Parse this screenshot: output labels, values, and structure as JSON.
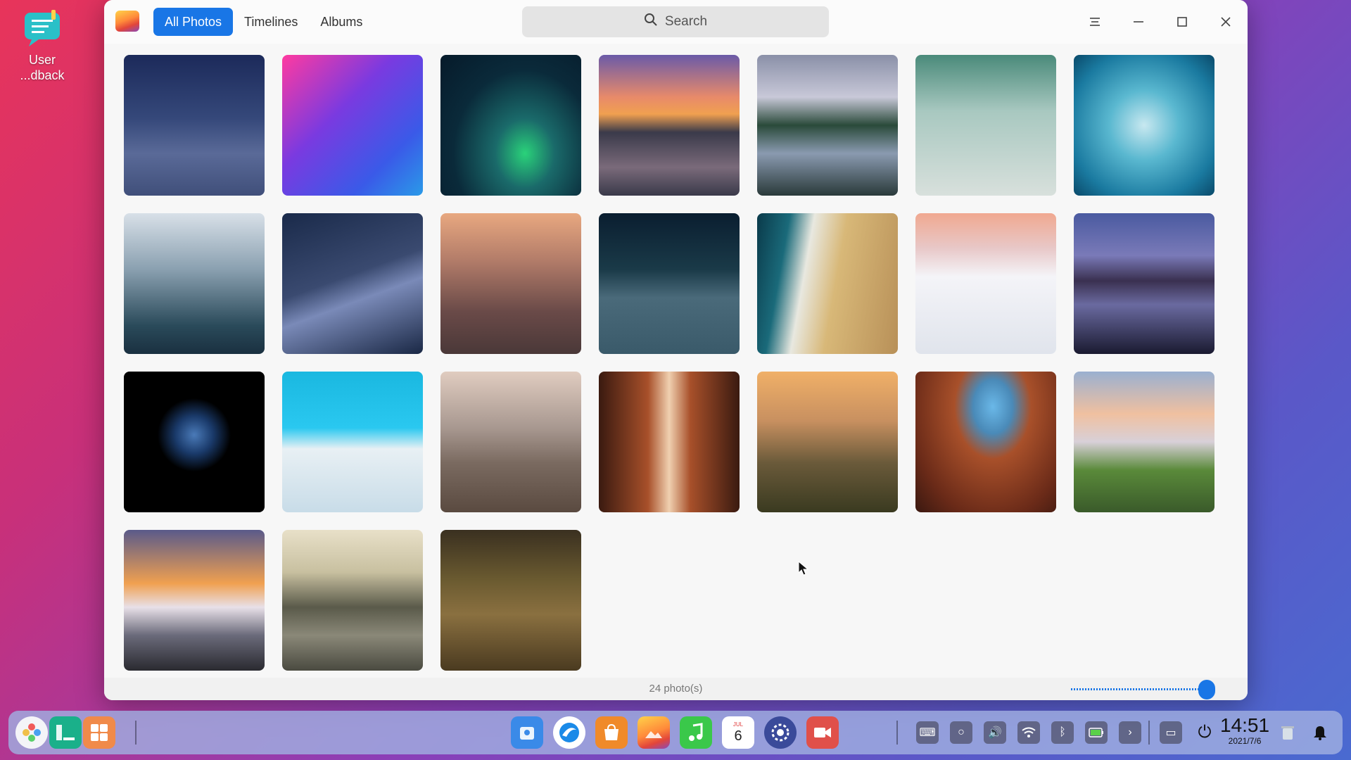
{
  "desktop": {
    "icon_label_line1": "User",
    "icon_label_line2": "...dback"
  },
  "window": {
    "tabs": [
      {
        "label": "All Photos",
        "active": true
      },
      {
        "label": "Timelines",
        "active": false
      },
      {
        "label": "Albums",
        "active": false
      }
    ],
    "search": {
      "placeholder": "Search"
    },
    "status": {
      "count_text": "24 photo(s)",
      "zoom_fraction": 1.0
    }
  },
  "photos": [
    {
      "name": "sand-ripples-night",
      "bg": "linear-gradient(180deg,#1c2a5a 0%,#35487a 45%,#5a6a98 70%,#404f7a 100%)"
    },
    {
      "name": "deepin-logo",
      "bg": "linear-gradient(135deg,#ff3aa0 0%,#7a3ae0 40%,#3a5ae8 75%,#2a9ae8 100%)"
    },
    {
      "name": "aurora",
      "bg": "radial-gradient(ellipse at 60% 70%,#2ad27a 0%,#1a6a6a 25%,#0a2a3a 60%,#061a2a 100%)"
    },
    {
      "name": "sunset-coast",
      "bg": "linear-gradient(180deg,#6a5aa8 0%,#e88a6a 30%,#f0a050 42%,#3a3a4a 55%,#7a6a7a 80%,#3a3a4a 100%)"
    },
    {
      "name": "mountain-lake",
      "bg": "linear-gradient(180deg,#8a90a8 0%,#c8c8d8 30%,#2a4a3a 50%,#8a9ab0 70%,#2a3a3a 100%)"
    },
    {
      "name": "waterfall-bird",
      "bg": "linear-gradient(180deg,#4a8a7a 0%,#a8c8c0 40%,#d8e0dc 100%)"
    },
    {
      "name": "jellyfish",
      "bg": "radial-gradient(circle at 50% 50%,#c8e8f0 0%,#5ab8d0 35%,#1a7aa0 75%,#0a4a6a 100%)"
    },
    {
      "name": "misty-forest",
      "bg": "linear-gradient(180deg,#d8e0e8 0%,#8aa0b0 40%,#2a4a5a 80%,#1a3040 100%)"
    },
    {
      "name": "blue-dune",
      "bg": "linear-gradient(160deg,#1a2a4a 0%,#3a4a70 45%,#7a8ab8 60%,#1a2845 100%)"
    },
    {
      "name": "desert-dusk",
      "bg": "linear-gradient(180deg,#e8a880 0%,#b07a68 35%,#6a4a48 70%,#4a3838 100%)"
    },
    {
      "name": "dark-clouds",
      "bg": "linear-gradient(180deg,#0a1e30 0%,#1a3a48 40%,#4a6a7a 60%,#3a5a6a 100%)"
    },
    {
      "name": "beach-aerial",
      "bg": "linear-gradient(100deg,#0a3a4a 0%,#1a6a7a 20%,#e8e8e0 35%,#d8b878 55%,#b89058 100%)"
    },
    {
      "name": "snowy-peak",
      "bg": "linear-gradient(180deg,#f0a890 0%,#e8c8c8 25%,#f4f4f8 45%,#e0e4ec 100%)"
    },
    {
      "name": "lake-reflection",
      "bg": "linear-gradient(180deg,#4a5aa0 0%,#7a7ab8 30%,#3a3050 48%,#6a6aa0 65%,#1a1a30 100%)"
    },
    {
      "name": "betta-fish",
      "bg": "radial-gradient(circle at 50% 45%,#4a7ab8 0%,#1a3a6a 18%,#000 35%,#000 100%)"
    },
    {
      "name": "white-pyramid",
      "bg": "linear-gradient(180deg,#1ab8e0 0%,#2ac8f0 40%,#e8f0f4 55%,#c8dce8 100%)"
    },
    {
      "name": "sand-dunes",
      "bg": "linear-gradient(180deg,#e0ccc0 0%,#a89890 40%,#7a6a60 65%,#5a4a40 100%)"
    },
    {
      "name": "antelope-canyon",
      "bg": "linear-gradient(90deg,#3a1a10 0%,#a8502a 35%,#f0d0b0 50%,#a8502a 65%,#3a1a10 100%)"
    },
    {
      "name": "mountain-sunrise",
      "bg": "linear-gradient(180deg,#f0b068 0%,#c89060 35%,#6a5a3a 65%,#3a3a20 100%)"
    },
    {
      "name": "canyon-arch",
      "bg": "radial-gradient(ellipse at 55% 25%,#6ab8e8 0%,#4a8ab8 18%,#a8502a 35%,#6a2a18 75%,#3a1810 100%)"
    },
    {
      "name": "green-valley",
      "bg": "linear-gradient(180deg,#9ab0d0 0%,#f0c0a0 30%,#d8d0d8 50%,#5a8a3a 70%,#3a5a2a 100%)"
    },
    {
      "name": "icy-sunset",
      "bg": "linear-gradient(180deg,#5a5a8a 0%,#f0a050 38%,#e8e0e8 55%,#6a6a7a 75%,#2a2a30 100%)"
    },
    {
      "name": "misty-lake",
      "bg": "linear-gradient(180deg,#e8e0c8 0%,#c8c0a0 30%,#5a5a4a 55%,#8a8878 75%,#4a4a40 100%)"
    },
    {
      "name": "autumn-forest",
      "bg": "linear-gradient(180deg,#3a3020 0%,#6a5a30 35%,#8a7040 60%,#4a3a20 100%)"
    }
  ],
  "dock": {
    "apps": [
      "launcher-icon",
      "multitask-icon",
      "app-store-icon",
      "file-manager-icon",
      "browser-icon",
      "store-bag-icon",
      "photos-icon",
      "music-icon",
      "calendar-icon",
      "control-center-icon",
      "screen-recorder-icon"
    ],
    "calendar_day": "6",
    "calendar_month": "JUL",
    "clock": {
      "time": "14:51",
      "date": "2021/7/6"
    }
  }
}
